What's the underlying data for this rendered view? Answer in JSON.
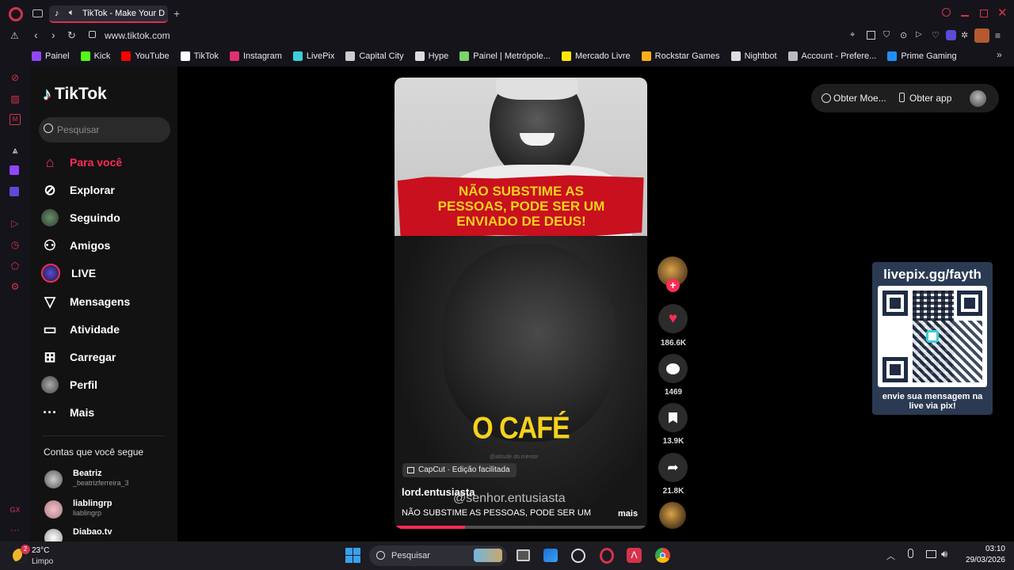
{
  "browser": {
    "tab_title": "TikTok - Make Your D",
    "url": "www.tiktok.com"
  },
  "bookmarks": [
    {
      "label": "Painel",
      "color": "#9146ff"
    },
    {
      "label": "Kick",
      "color": "#53fc18"
    },
    {
      "label": "YouTube",
      "color": "#ff0000"
    },
    {
      "label": "TikTok",
      "color": "#ffffff"
    },
    {
      "label": "Instagram",
      "color": "#e1306c"
    },
    {
      "label": "LivePix",
      "color": "#39d0d8"
    },
    {
      "label": "Capital City",
      "color": "#cccccc"
    },
    {
      "label": "Hype",
      "color": "#dddddd"
    },
    {
      "label": "Painel | Metrópole...",
      "color": "#7bd36b"
    },
    {
      "label": "Mercado Livre",
      "color": "#ffe600"
    },
    {
      "label": "Rockstar Games",
      "color": "#fcaf17"
    },
    {
      "label": "Nightbot",
      "color": "#dddddd"
    },
    {
      "label": "Account - Prefere...",
      "color": "#bbbbbb"
    },
    {
      "label": "Prime Gaming",
      "color": "#1f8fff"
    }
  ],
  "tiktok": {
    "logo": "TikTok",
    "search_placeholder": "Pesquisar",
    "nav": [
      {
        "label": "Para você",
        "icon": "home-icon",
        "active": true
      },
      {
        "label": "Explorar",
        "icon": "compass-icon"
      },
      {
        "label": "Seguindo",
        "icon": "following-avatar-icon"
      },
      {
        "label": "Amigos",
        "icon": "friends-icon"
      },
      {
        "label": "LIVE",
        "icon": "live-icon"
      },
      {
        "label": "Mensagens",
        "icon": "send-icon"
      },
      {
        "label": "Atividade",
        "icon": "activity-icon"
      },
      {
        "label": "Carregar",
        "icon": "upload-icon"
      },
      {
        "label": "Perfil",
        "icon": "profile-avatar-icon"
      },
      {
        "label": "Mais",
        "icon": "more-icon"
      }
    ],
    "following_heading": "Contas que você segue",
    "following": [
      {
        "name": "Beatriz",
        "handle": "_beatrizferreira_3"
      },
      {
        "name": "liablingrp",
        "handle": "liablingrp"
      },
      {
        "name": "Diabao.tv",
        "handle": ""
      }
    ],
    "top_right": {
      "coins": "Obter Moe...",
      "app": "Obter app"
    },
    "video": {
      "banner_text": "NÃO SUBSTIME AS PESSOAS, PODE SER UM ENVIADO DE DEUS!",
      "caption_big": "O CAFÉ",
      "watermark_small": "@atitude.do.mentor",
      "capcut": "CapCut · Edição facilitada",
      "author": "lord.entusiasta",
      "overlay_handle": "@senhor.entusiasta",
      "description": "NÃO SUBSTIME AS PESSOAS, PODE SER UM",
      "more": "mais",
      "progress": 0.28
    },
    "actions": {
      "likes": "186.6K",
      "comments": "1469",
      "saves": "13.9K",
      "shares": "21.8K"
    }
  },
  "overlay": {
    "url": "livepix.gg/fayth",
    "footer": "envie sua mensagem na live via pix!"
  },
  "taskbar": {
    "weather_temp": "23°C",
    "weather_desc": "Limpo",
    "weather_badge": "2",
    "search": "Pesquisar",
    "time": "03:10",
    "date": "29/03/2026"
  },
  "colors": {
    "accent": "#fe2c55",
    "opera_red": "#d6334c",
    "banner_red": "#c8101e",
    "caption_yellow": "#f5d21c"
  }
}
